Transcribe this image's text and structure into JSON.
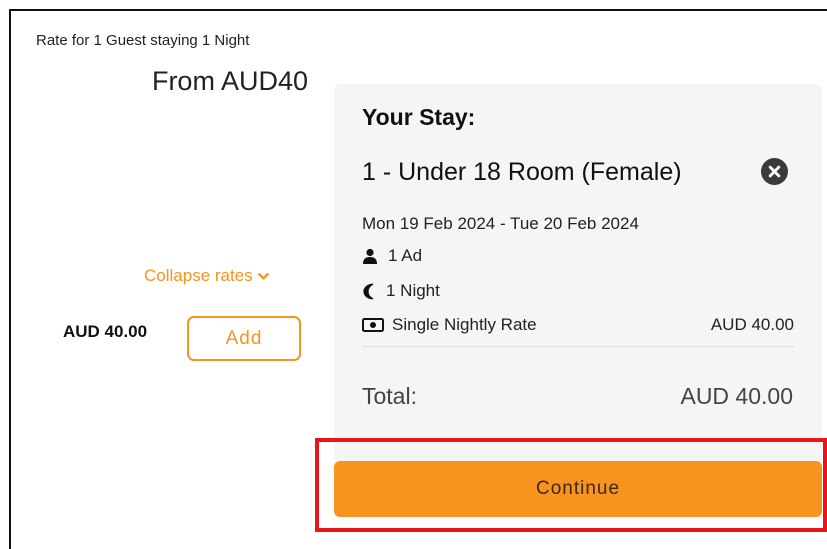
{
  "rates": {
    "caption": "Rate for 1 Guest staying 1 Night",
    "from_price": "From AUD40",
    "collapse_label": "Collapse rates",
    "rate_price": "AUD 40.00",
    "add_label": "Add"
  },
  "stay": {
    "title": "Your Stay:",
    "room": "1 - Under 18 Room (Female)",
    "dates": "Mon 19 Feb 2024 - Tue 20 Feb 2024",
    "guests": "1 Ad",
    "nights": "1 Night",
    "rate_name": "Single Nightly Rate",
    "rate_amount": "AUD 40.00",
    "total_label": "Total:",
    "total_value": "AUD 40.00",
    "continue_label": "Continue"
  },
  "icons": {
    "collapse": "chevron-down-icon",
    "remove": "close-circle-icon",
    "guests": "user-icon",
    "nights": "moon-icon",
    "rate": "money-icon"
  },
  "colors": {
    "accent": "#f7931e",
    "highlight": "#e8151b",
    "panel": "#f5f5f5"
  }
}
